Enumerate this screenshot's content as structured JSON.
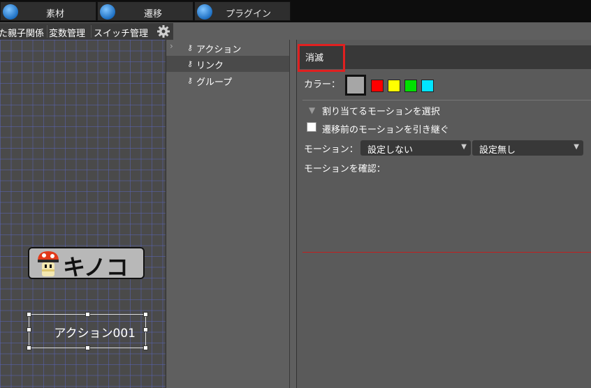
{
  "tabs": [
    {
      "label": "素材",
      "icon": "layers-icon"
    },
    {
      "label": "遷移",
      "icon": "link-icon"
    },
    {
      "label": "プラグイン",
      "icon": "plugin-icon"
    }
  ],
  "toolbar": {
    "items": [
      "た親子関係",
      "変数管理",
      "スイッチ管理"
    ],
    "settings_icon": "gear-icon"
  },
  "canvas": {
    "object_label": "キノコ",
    "action_label": "アクション001"
  },
  "middle_menu": {
    "items": [
      {
        "label": "アクション",
        "selected": false
      },
      {
        "label": "リンク",
        "selected": true
      },
      {
        "label": "グループ",
        "selected": false
      }
    ]
  },
  "properties": {
    "name": "消滅",
    "color_label": "カラー：",
    "colors": [
      "#a6a6a6",
      "#ff0000",
      "#ffff00",
      "#00e000",
      "#00e5ff"
    ],
    "motion_select_label": "割り当てるモーションを選択",
    "inherit_label": "遷移前のモーションを引き継ぐ",
    "motion_label": "モーション：",
    "motion_value": "設定しない",
    "setting_value": "設定無し",
    "confirm_label": "モーションを確認："
  }
}
